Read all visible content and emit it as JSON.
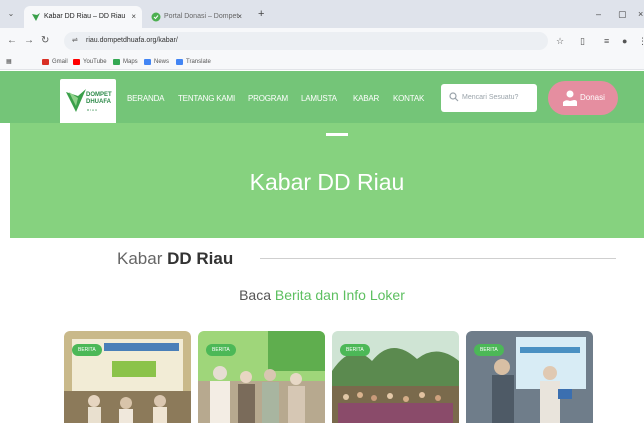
{
  "browser": {
    "tabs": [
      {
        "title": "Kabar DD Riau – DD Riau",
        "active": true
      },
      {
        "title": "Portal Donasi – Dompet Dhuafa",
        "active": false
      }
    ],
    "close_glyph": "×",
    "new_tab_glyph": "+",
    "url_prefix": "riau.dompetdhuafa.org",
    "url_path": "/kabar/",
    "bookmarks": [
      {
        "label": "Gmail",
        "icon": "gmail-icon",
        "color": "#d93025"
      },
      {
        "label": "YouTube",
        "icon": "youtube-icon",
        "color": "#ff0000"
      },
      {
        "label": "Maps",
        "icon": "maps-icon",
        "color": "#34a853"
      },
      {
        "label": "News",
        "icon": "news-icon",
        "color": "#4285f4"
      },
      {
        "label": "Translate",
        "icon": "translate-icon",
        "color": "#4285f4"
      }
    ]
  },
  "site": {
    "logo_text_line1": "DOMPET",
    "logo_text_line2": "DHUAFA",
    "logo_sub": "RIAU",
    "menu": [
      {
        "label": "BERANDA"
      },
      {
        "label": "TENTANG KAMI"
      },
      {
        "label": "PROGRAM"
      },
      {
        "label": "LAMUSTA"
      },
      {
        "label": "KABAR"
      },
      {
        "label": "KONTAK"
      }
    ],
    "search_placeholder": "Mencari Sesuatu?",
    "donate_label": "Donasi",
    "colors": {
      "header_green": "#74c578",
      "hero_green": "#86d27f",
      "accent_pink": "#e58ea0",
      "badge_green": "#4cb857",
      "highlight_green": "#5cbf5f"
    }
  },
  "hero": {
    "title": "Kabar DD Riau"
  },
  "section": {
    "heading_prefix": "Kabar",
    "heading_bold": "DD Riau",
    "subheading_prefix": "Baca",
    "subheading_highlight": "Berita dan Info Loker"
  },
  "cards": [
    {
      "badge": "BERITA"
    },
    {
      "badge": "BERITA"
    },
    {
      "badge": "BERITA"
    },
    {
      "badge": "BERITA"
    }
  ]
}
